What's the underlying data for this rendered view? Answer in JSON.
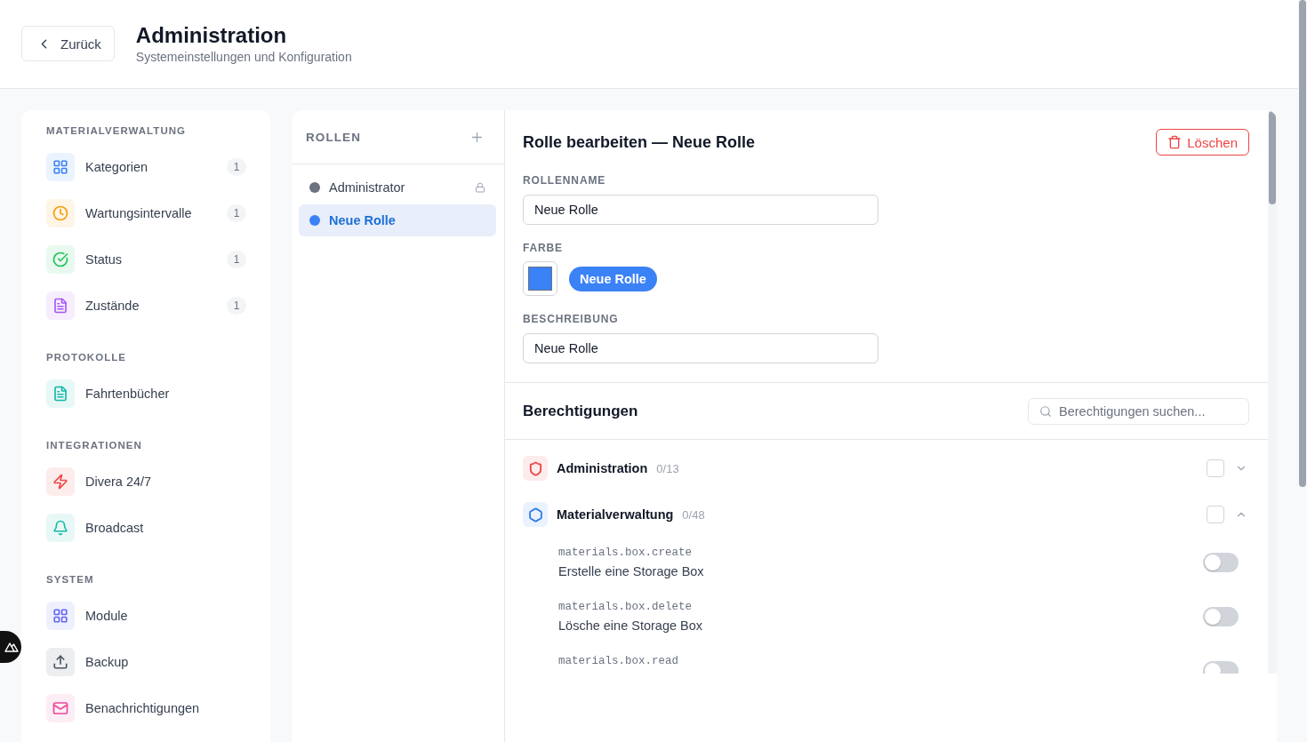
{
  "header": {
    "back_button": "Zurück",
    "title": "Administration",
    "subtitle": "Systemeinstellungen und Konfiguration"
  },
  "sidebar": {
    "sections": [
      {
        "heading": "MATERIALVERWALTUNG",
        "items": [
          {
            "label": "Kategorien",
            "count": "1",
            "color": "#3b82f6"
          },
          {
            "label": "Wartungsintervalle",
            "count": "1",
            "color": "#f59e0b"
          },
          {
            "label": "Status",
            "count": "1",
            "color": "#22c55e"
          },
          {
            "label": "Zustände",
            "count": "1",
            "color": "#a855f7"
          }
        ]
      },
      {
        "heading": "PROTOKOLLE",
        "items": [
          {
            "label": "Fahrtenbücher",
            "color": "#14b8a6"
          }
        ]
      },
      {
        "heading": "INTEGRATIONEN",
        "items": [
          {
            "label": "Divera 24/7",
            "color": "#ef4444"
          },
          {
            "label": "Broadcast",
            "color": "#14b8a6"
          }
        ]
      },
      {
        "heading": "SYSTEM",
        "items": [
          {
            "label": "Module",
            "color": "#6366f1"
          },
          {
            "label": "Backup",
            "color": "#4b5563"
          },
          {
            "label": "Benachrichtigungen",
            "color": "#ec4899"
          }
        ]
      }
    ]
  },
  "roles": {
    "heading": "ROLLEN",
    "items": [
      {
        "name": "Administrator",
        "color": "#6b7280",
        "locked": true,
        "selected": false
      },
      {
        "name": "Neue Rolle",
        "color": "#3b82f6",
        "locked": false,
        "selected": true
      }
    ]
  },
  "editor": {
    "title": "Rolle bearbeiten — Neue Rolle",
    "delete_button": "Löschen",
    "fields": [
      {
        "kind": "text",
        "label": "ROLLENNAME",
        "value": "Neue Rolle"
      },
      {
        "kind": "color",
        "label": "FARBE",
        "color": "#3b82f6",
        "preview": "Neue Rolle"
      },
      {
        "kind": "text",
        "label": "BESCHREIBUNG",
        "value": "Neue Rolle"
      }
    ]
  },
  "permissions": {
    "title": "Berechtigungen",
    "search": {
      "placeholder": "Berechtigungen suchen..."
    },
    "groups": [
      {
        "name": "Administration",
        "count": "0/13",
        "color": "#ef4444",
        "checked": false,
        "expanded": false
      },
      {
        "name": "Materialverwaltung",
        "count": "0/48",
        "color": "#2f7be6",
        "checked": false,
        "expanded": true,
        "items": [
          {
            "key": "materials.box.create",
            "description": "Erstelle eine Storage Box",
            "on": false
          },
          {
            "key": "materials.box.delete",
            "description": "Lösche eine Storage Box",
            "on": false
          },
          {
            "key": "materials.box.read",
            "on": false
          }
        ]
      }
    ]
  }
}
